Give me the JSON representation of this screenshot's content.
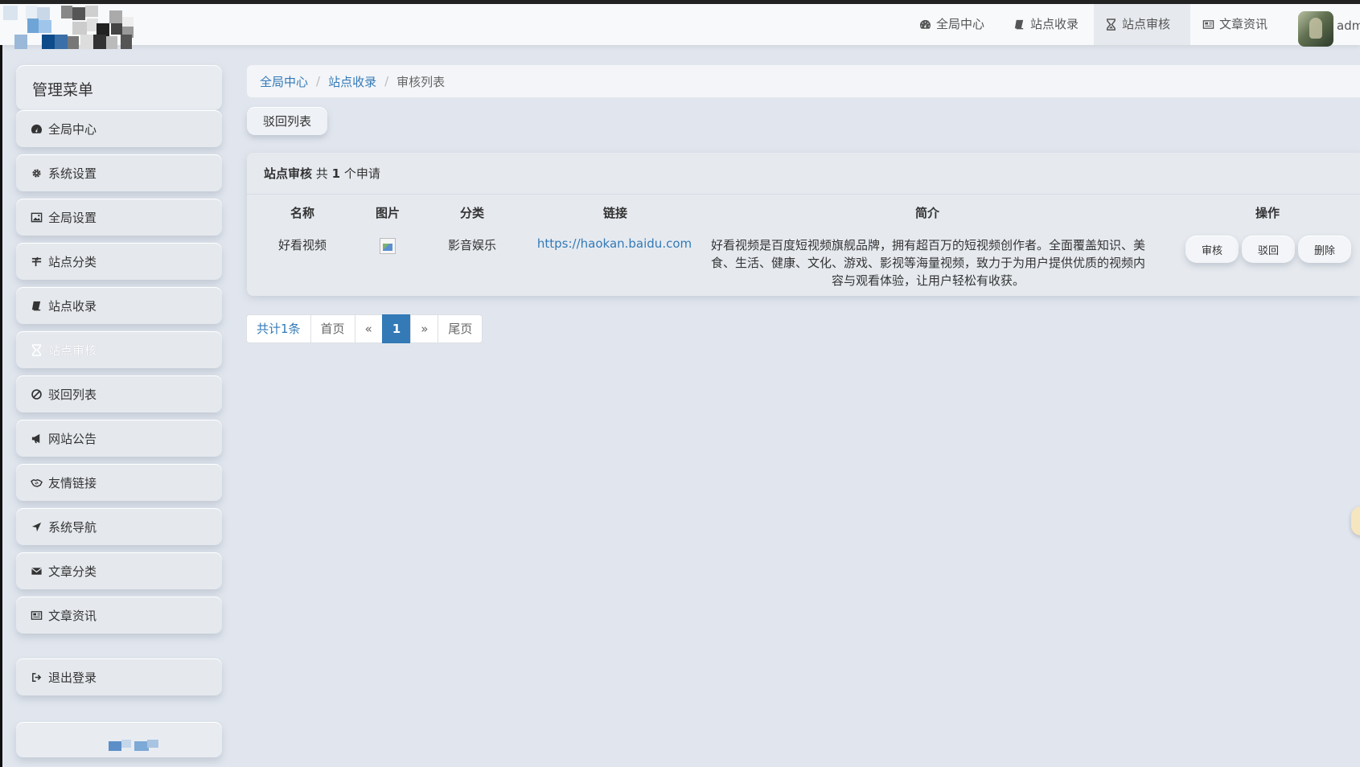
{
  "topnav": [
    {
      "label": "全局中心",
      "icon": "dashboard-icon"
    },
    {
      "label": "站点收录",
      "icon": "book-icon"
    },
    {
      "label": "站点审核",
      "icon": "hourglass-icon",
      "active": true
    },
    {
      "label": "文章资讯",
      "icon": "newspaper-icon"
    }
  ],
  "user": {
    "name": "adm"
  },
  "sidebar": {
    "title": "管理菜单",
    "items": [
      {
        "label": "全局中心",
        "icon": "dashboard-icon"
      },
      {
        "label": "系统设置",
        "icon": "gear-icon"
      },
      {
        "label": "全局设置",
        "icon": "image-icon"
      },
      {
        "label": "站点分类",
        "icon": "columns-icon"
      },
      {
        "label": "站点收录",
        "icon": "book-icon"
      },
      {
        "label": "站点审核",
        "icon": "hourglass-icon",
        "active": true
      },
      {
        "label": "驳回列表",
        "icon": "ban-icon"
      },
      {
        "label": "网站公告",
        "icon": "bullhorn-icon"
      },
      {
        "label": "友情链接",
        "icon": "handshake-icon"
      },
      {
        "label": "系统导航",
        "icon": "location-arrow-icon"
      },
      {
        "label": "文章分类",
        "icon": "envelope-icon"
      },
      {
        "label": "文章资讯",
        "icon": "newspaper-icon"
      }
    ],
    "logout": {
      "label": "退出登录",
      "icon": "sign-out-icon"
    }
  },
  "breadcrumb": {
    "home": "全局中心",
    "section": "站点收录",
    "current": "审核列表"
  },
  "rejected_button": "驳回列表",
  "panel": {
    "title": "站点审核",
    "count_prefix": "共",
    "count": "1",
    "count_suffix": "个申请",
    "columns": [
      "名称",
      "图片",
      "分类",
      "链接",
      "简介",
      "操作"
    ],
    "rows": [
      {
        "name": "好看视频",
        "category": "影音娱乐",
        "link": "https://haokan.baidu.com",
        "description": "好看视频是百度短视频旗舰品牌，拥有超百万的短视频创作者。全面覆盖知识、美食、生活、健康、文化、游戏、影视等海量视频，致力于为用户提供优质的视频内容与观看体验，让用户轻松有收获。",
        "actions": [
          "审核",
          "驳回",
          "删除"
        ]
      }
    ]
  },
  "pagination": {
    "total": "共计1条",
    "first": "首页",
    "prev": "«",
    "current": "1",
    "next": "»",
    "last": "尾页"
  },
  "colors": {
    "accent": "#337ab7",
    "background": "#e1e6ee"
  }
}
